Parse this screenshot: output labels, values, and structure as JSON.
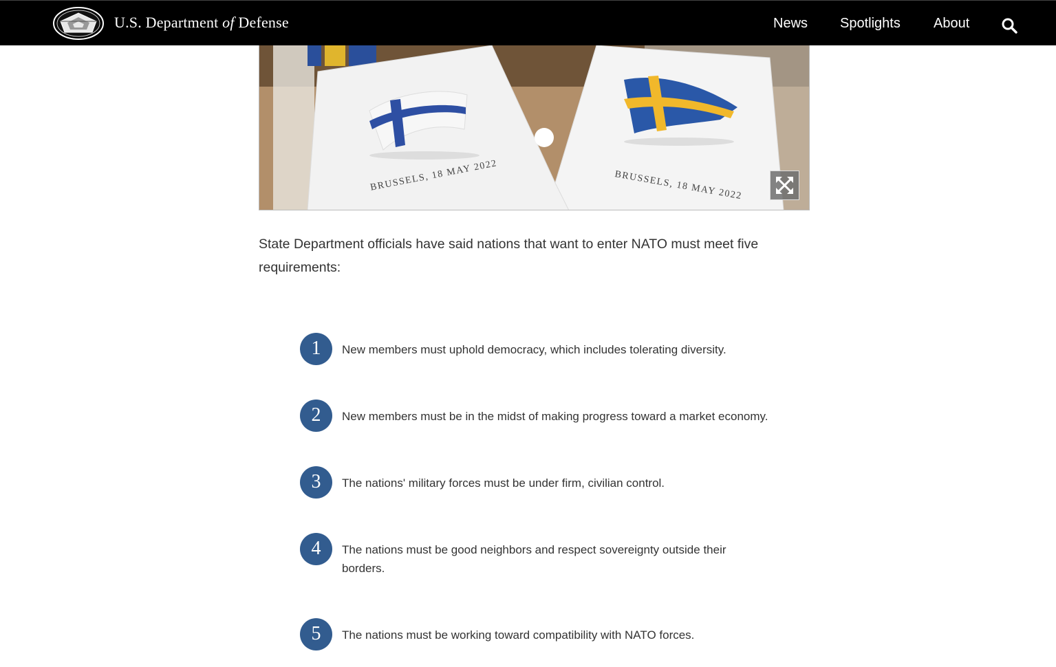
{
  "header": {
    "title_prefix": "U.S. Department",
    "title_of": "of",
    "title_suffix": "Defense",
    "nav": [
      {
        "label": "News"
      },
      {
        "label": "Spotlights"
      },
      {
        "label": "About"
      }
    ],
    "search_icon": "search-icon",
    "logo_icon": "pentagon-seal"
  },
  "hero": {
    "left_card_caption": "BRUSSELS, 18 MAY 2022",
    "right_card_caption": "BRUSSELS, 18 MAY 2022",
    "expand_icon": "expand-icon"
  },
  "article": {
    "intro": "State Department officials have said nations that want to enter NATO must meet five requirements:",
    "requirements": [
      {
        "number": "1",
        "text": "New members must uphold democracy, which includes tolerating diversity."
      },
      {
        "number": "2",
        "text": "New members must be in the midst of making progress toward a market economy."
      },
      {
        "number": "3",
        "text": "The nations' military forces must be under firm, civilian control."
      },
      {
        "number": "4",
        "text": "The nations must be good neighbors and respect sovereignty outside their borders."
      },
      {
        "number": "5",
        "text": "The nations must be working toward compatibility with NATO forces."
      }
    ]
  },
  "colors": {
    "header_bg": "#000000",
    "number_badge": "#325c8f",
    "body_text": "#333333"
  }
}
